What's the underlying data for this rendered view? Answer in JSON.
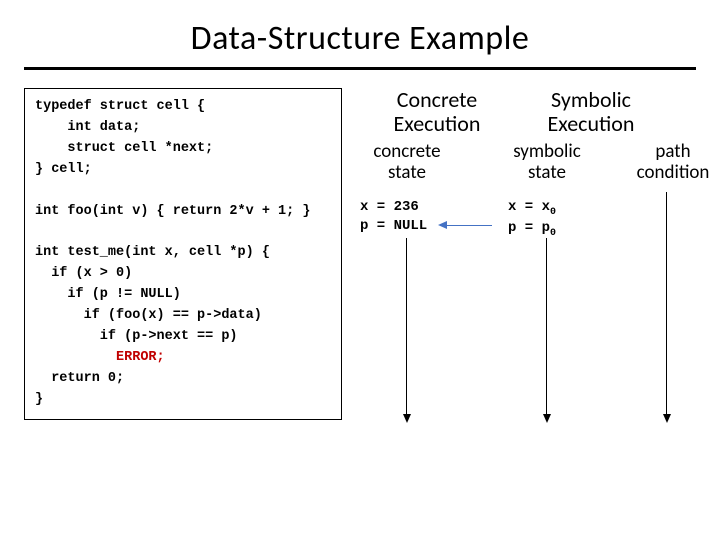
{
  "title": "Data-Structure Example",
  "code": {
    "l1": "typedef struct cell {",
    "l2": "    int data;",
    "l3": "    struct cell *next;",
    "l4": "} cell;",
    "l5": "",
    "l6": "int foo(int v) { return 2*v + 1; }",
    "l7": "",
    "l8": "int test_me(int x, cell *p) {",
    "l9": "  if (x > 0)",
    "l10": "    if (p != NULL)",
    "l11": "      if (foo(x) == p->data)",
    "l12": "        if (p->next == p)",
    "l13_indent": "          ",
    "l13_err": "ERROR;",
    "l14": "  return 0;",
    "l15": "}"
  },
  "headers": {
    "concrete_exec_l1": "Concrete",
    "concrete_exec_l2": "Execution",
    "symbolic_exec_l1": "Symbolic",
    "symbolic_exec_l2": "Execution",
    "concrete_state_l1": "concrete",
    "concrete_state_l2": "state",
    "symbolic_state_l1": "symbolic",
    "symbolic_state_l2": "state",
    "path_cond_l1": "path",
    "path_cond_l2": "condition"
  },
  "states": {
    "concrete_l1": "x = 236",
    "concrete_l2": "p = NULL",
    "symbolic_x_pre": "x = x",
    "symbolic_x_sub": "0",
    "symbolic_p_pre": "p = p",
    "symbolic_p_sub": "0"
  }
}
